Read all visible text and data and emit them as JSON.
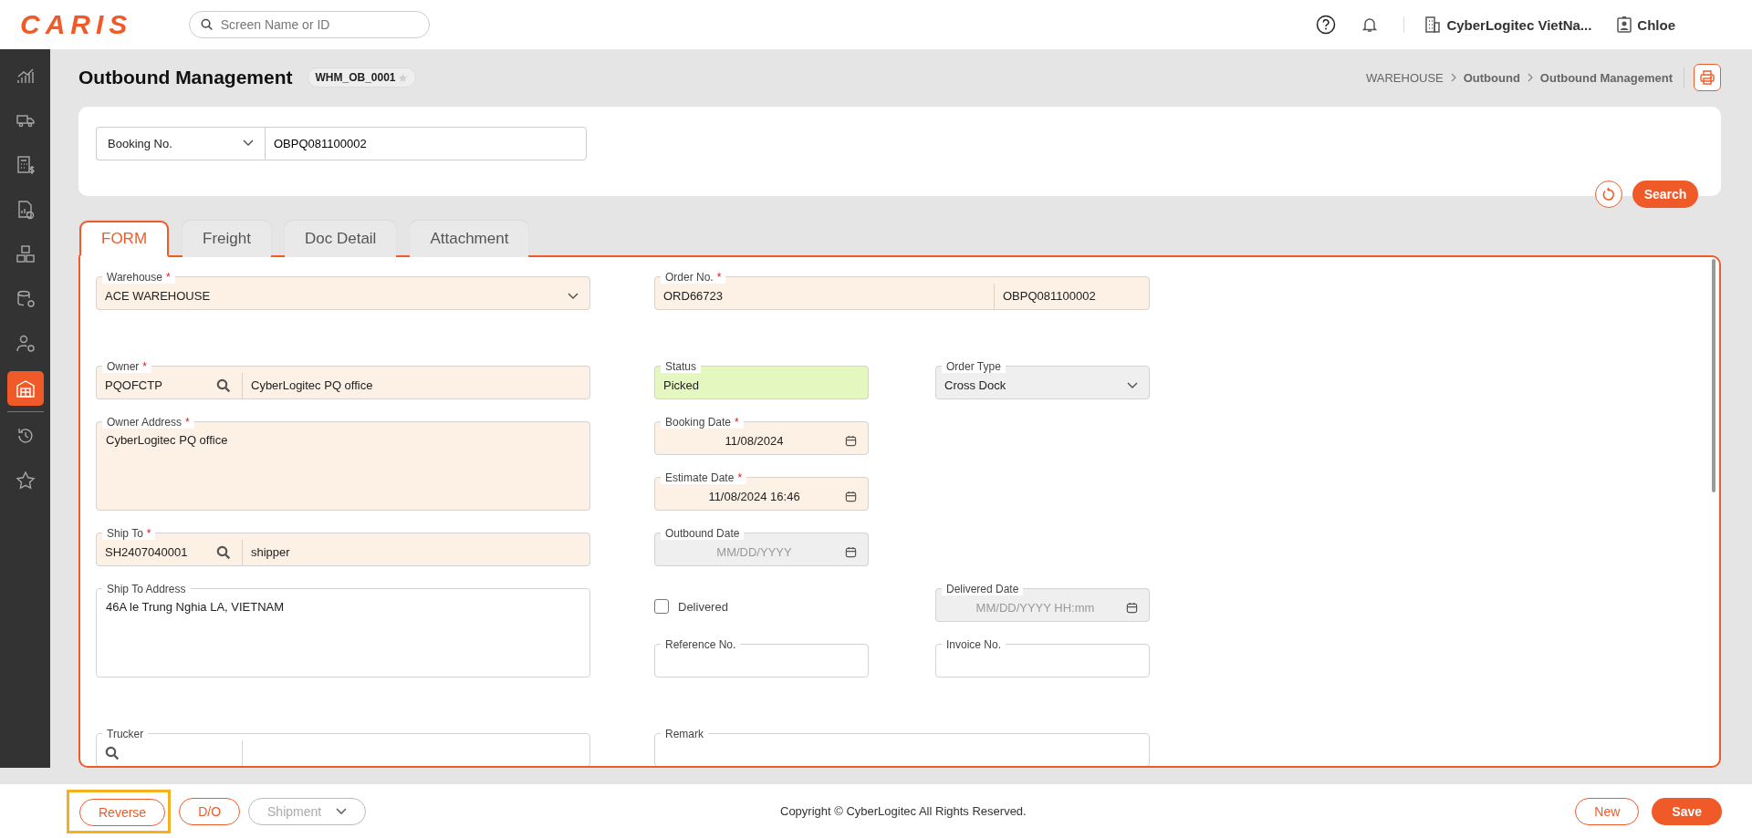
{
  "header": {
    "logo": "CARIS",
    "search_placeholder": "Screen Name or ID",
    "company": "CyberLogitec VietNa...",
    "user": "Chloe"
  },
  "sidebar": {
    "items": [
      {
        "selected": false
      },
      {
        "selected": false
      },
      {
        "selected": false
      },
      {
        "selected": false
      },
      {
        "selected": false
      },
      {
        "selected": false
      },
      {
        "selected": false
      },
      {
        "selected": true
      },
      {
        "selected": false
      },
      {
        "selected": false
      }
    ]
  },
  "page": {
    "title": "Outbound Management",
    "screen_id": "WHM_OB_0001",
    "favorite": false,
    "breadcrumb": [
      "WAREHOUSE",
      "Outbound",
      "Outbound Management"
    ]
  },
  "search": {
    "criteria": "Booking No.",
    "value": "OBPQ081100002",
    "button": "Search"
  },
  "tabs": [
    {
      "label": "FORM",
      "selected": true
    },
    {
      "label": "Freight",
      "selected": false
    },
    {
      "label": "Doc Detail",
      "selected": false
    },
    {
      "label": "Attachment",
      "selected": false
    }
  ],
  "form": {
    "required_mark": "*",
    "fields": [
      {
        "kind": "select",
        "label": "Warehouse",
        "required": true,
        "disabled": false,
        "value": "ACE WAREHOUSE"
      },
      {
        "kind": "split",
        "label": "Order No.",
        "required": true,
        "disabled": false,
        "value": "ORD66723",
        "value_2": "OBPQ081100002"
      },
      {
        "kind": "lookup",
        "label": "Owner",
        "required": true,
        "disabled": false,
        "code": "PQOFCTP",
        "value": "CyberLogitec PQ office"
      },
      {
        "kind": "status",
        "label": "Status",
        "required": false,
        "disabled": false,
        "value": "Picked"
      },
      {
        "kind": "select",
        "label": "Order Type",
        "required": false,
        "disabled": true,
        "value": "Cross Dock"
      },
      {
        "kind": "textarea",
        "label": "Owner Address",
        "required": true,
        "disabled": false,
        "value": "CyberLogitec PQ office"
      },
      {
        "kind": "date",
        "label": "Booking Date",
        "required": true,
        "disabled": false,
        "value": "11/08/2024"
      },
      {
        "kind": "date",
        "label": "Estimate Date",
        "required": true,
        "disabled": false,
        "value": "11/08/2024 16:46"
      },
      {
        "kind": "lookup",
        "label": "Ship To",
        "required": true,
        "disabled": false,
        "code": "SH2407040001",
        "value": "shipper"
      },
      {
        "kind": "date",
        "label": "Outbound Date",
        "required": false,
        "disabled": true,
        "placeholder": "MM/DD/YYYY"
      },
      {
        "kind": "textarea",
        "label": "Ship To Address",
        "required": false,
        "disabled": false,
        "value": "46A le Trung Nghia LA, VIETNAM"
      },
      {
        "kind": "checkbox",
        "label": "Delivered",
        "checked": false
      },
      {
        "kind": "date",
        "label": "Delivered Date",
        "required": false,
        "disabled": true,
        "placeholder": "MM/DD/YYYY HH:mm"
      },
      {
        "kind": "text",
        "label": "Reference No.",
        "required": false,
        "disabled": false
      },
      {
        "kind": "text",
        "label": "Invoice No.",
        "required": false,
        "disabled": false
      },
      {
        "kind": "lookup",
        "label": "Trucker",
        "required": false,
        "disabled": false
      },
      {
        "kind": "text",
        "label": "Remark",
        "required": false,
        "disabled": false
      }
    ]
  },
  "footer": {
    "left_buttons": [
      {
        "label": "Reverse",
        "kind": "outline",
        "highlighted": true,
        "disabled": false
      },
      {
        "label": "D/O",
        "kind": "outline",
        "highlighted": false,
        "disabled": false
      },
      {
        "label": "Shipment",
        "kind": "dropdown",
        "highlighted": false,
        "disabled": true
      }
    ],
    "copyright": "Copyright © CyberLogitec All Rights Reserved.",
    "right_buttons": [
      {
        "label": "New",
        "kind": "outline",
        "highlighted": false,
        "disabled": false
      },
      {
        "label": "Save",
        "kind": "primary",
        "highlighted": false,
        "disabled": false
      }
    ]
  }
}
